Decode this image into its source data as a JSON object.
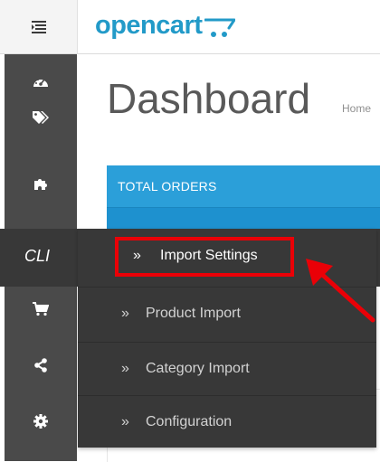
{
  "header": {
    "menu_toggle_icon": "menu-toggle-icon",
    "logo_text": "opencart",
    "logo_cart_icon": "cart-logo-icon"
  },
  "sidebar": {
    "items": [
      {
        "icon": "dashboard-icon"
      },
      {
        "icon": "tags-icon"
      },
      {
        "icon": "puzzle-icon"
      },
      {
        "label": "CLI"
      },
      {
        "icon": "shopping-cart-icon"
      },
      {
        "icon": "share-icon"
      },
      {
        "icon": "gear-icon"
      }
    ]
  },
  "main": {
    "title": "Dashboard",
    "breadcrumb": "Home",
    "tile": {
      "title": "TOTAL ORDERS"
    }
  },
  "submenu": {
    "items": [
      {
        "chevron": "»",
        "label": "Import Settings"
      },
      {
        "chevron": "»",
        "label": "Product Import"
      },
      {
        "chevron": "»",
        "label": "Category Import"
      },
      {
        "chevron": "»",
        "label": "Configuration"
      }
    ]
  },
  "annotation": {
    "highlight_color": "#ea0007"
  },
  "colors": {
    "brand": "#229ac8",
    "sidebar": "#4a4a4a",
    "menu": "#383838",
    "tile": "#2b9fd9"
  }
}
